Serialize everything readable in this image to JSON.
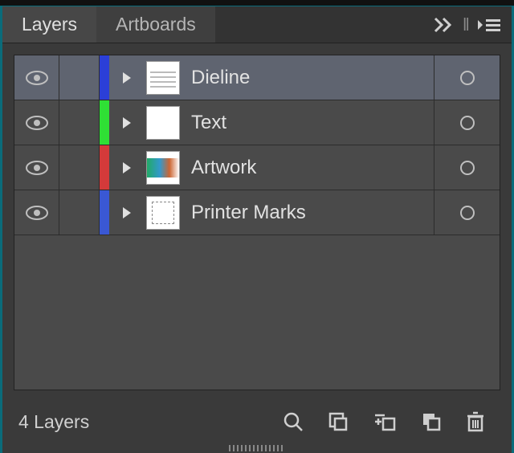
{
  "tabs": [
    {
      "label": "Layers",
      "active": true
    },
    {
      "label": "Artboards",
      "active": false
    }
  ],
  "layers": [
    {
      "name": "Dieline",
      "color": "#2b3fd8",
      "selected": true,
      "thumb": "lines"
    },
    {
      "name": "Text",
      "color": "#2fe035",
      "selected": false,
      "thumb": "empty"
    },
    {
      "name": "Artwork",
      "color": "#d43a3a",
      "selected": false,
      "thumb": "art"
    },
    {
      "name": "Printer Marks",
      "color": "#3a58d4",
      "selected": false,
      "thumb": "marks"
    }
  ],
  "footer": {
    "count_label": "4 Layers"
  }
}
